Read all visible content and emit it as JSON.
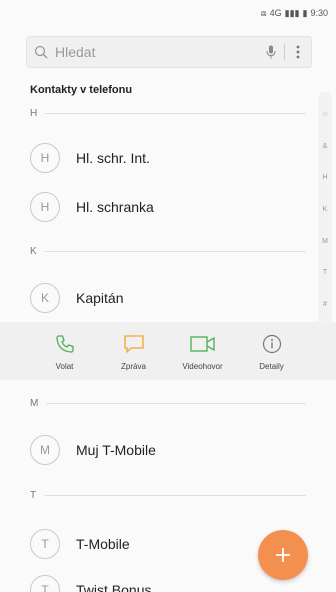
{
  "status_bar": {
    "signal": "▮▮▮",
    "network": "4G",
    "battery": "▮",
    "time": "9:30"
  },
  "search": {
    "placeholder": "Hledat"
  },
  "section_title": "Kontakty v telefonu",
  "groups": [
    {
      "letter": "H",
      "contacts": [
        {
          "initial": "H",
          "name": "Hl. schr. Int."
        },
        {
          "initial": "H",
          "name": "Hl. schranka"
        }
      ]
    },
    {
      "letter": "K",
      "contacts": [
        {
          "initial": "K",
          "name": "Kapitán"
        }
      ]
    },
    {
      "letter": "M",
      "contacts": [
        {
          "initial": "M",
          "name": "Muj T-Mobile"
        }
      ]
    },
    {
      "letter": "T",
      "contacts": [
        {
          "initial": "T",
          "name": "T-Mobile"
        },
        {
          "initial": "T",
          "name": "Twist Bonus"
        }
      ]
    }
  ],
  "index": [
    "☆",
    "&",
    "H",
    "K",
    "M",
    "T",
    "#"
  ],
  "actions": [
    {
      "label": "Volat",
      "icon": "phone-icon",
      "color": "#4caf50"
    },
    {
      "label": "Zpráva",
      "icon": "message-icon",
      "color": "#f5a623"
    },
    {
      "label": "Videohovor",
      "icon": "video-icon",
      "color": "#4caf50"
    },
    {
      "label": "Detaily",
      "icon": "info-icon",
      "color": "#777777"
    }
  ],
  "fab": {
    "icon": "plus-icon",
    "color": "#f3904f"
  }
}
